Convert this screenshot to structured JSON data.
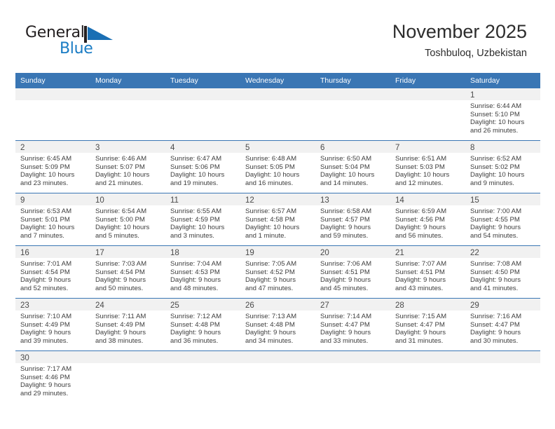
{
  "brand": {
    "name_top": "General",
    "name_bottom": "Blue",
    "flag_icon": "triangle-flag-icon",
    "color_top": "#231f20",
    "color_bottom": "#1a7cc4"
  },
  "header": {
    "title": "November 2025",
    "subtitle": "Toshbuloq, Uzbekistan"
  },
  "colors": {
    "header_blue": "#3a76b4",
    "daynum_band": "#f1f1f1",
    "text": "#3d3d3d"
  },
  "weekday_headers": [
    "Sunday",
    "Monday",
    "Tuesday",
    "Wednesday",
    "Thursday",
    "Friday",
    "Saturday"
  ],
  "weeks": [
    [
      {
        "day": "",
        "sunrise": "",
        "sunset": "",
        "daylight1": "",
        "daylight2": "",
        "empty": true
      },
      {
        "day": "",
        "sunrise": "",
        "sunset": "",
        "daylight1": "",
        "daylight2": "",
        "empty": true
      },
      {
        "day": "",
        "sunrise": "",
        "sunset": "",
        "daylight1": "",
        "daylight2": "",
        "empty": true
      },
      {
        "day": "",
        "sunrise": "",
        "sunset": "",
        "daylight1": "",
        "daylight2": "",
        "empty": true
      },
      {
        "day": "",
        "sunrise": "",
        "sunset": "",
        "daylight1": "",
        "daylight2": "",
        "empty": true
      },
      {
        "day": "",
        "sunrise": "",
        "sunset": "",
        "daylight1": "",
        "daylight2": "",
        "empty": true
      },
      {
        "day": "1",
        "sunrise": "Sunrise: 6:44 AM",
        "sunset": "Sunset: 5:10 PM",
        "daylight1": "Daylight: 10 hours",
        "daylight2": "and 26 minutes."
      }
    ],
    [
      {
        "day": "2",
        "sunrise": "Sunrise: 6:45 AM",
        "sunset": "Sunset: 5:09 PM",
        "daylight1": "Daylight: 10 hours",
        "daylight2": "and 23 minutes."
      },
      {
        "day": "3",
        "sunrise": "Sunrise: 6:46 AM",
        "sunset": "Sunset: 5:07 PM",
        "daylight1": "Daylight: 10 hours",
        "daylight2": "and 21 minutes."
      },
      {
        "day": "4",
        "sunrise": "Sunrise: 6:47 AM",
        "sunset": "Sunset: 5:06 PM",
        "daylight1": "Daylight: 10 hours",
        "daylight2": "and 19 minutes."
      },
      {
        "day": "5",
        "sunrise": "Sunrise: 6:48 AM",
        "sunset": "Sunset: 5:05 PM",
        "daylight1": "Daylight: 10 hours",
        "daylight2": "and 16 minutes."
      },
      {
        "day": "6",
        "sunrise": "Sunrise: 6:50 AM",
        "sunset": "Sunset: 5:04 PM",
        "daylight1": "Daylight: 10 hours",
        "daylight2": "and 14 minutes."
      },
      {
        "day": "7",
        "sunrise": "Sunrise: 6:51 AM",
        "sunset": "Sunset: 5:03 PM",
        "daylight1": "Daylight: 10 hours",
        "daylight2": "and 12 minutes."
      },
      {
        "day": "8",
        "sunrise": "Sunrise: 6:52 AM",
        "sunset": "Sunset: 5:02 PM",
        "daylight1": "Daylight: 10 hours",
        "daylight2": "and 9 minutes."
      }
    ],
    [
      {
        "day": "9",
        "sunrise": "Sunrise: 6:53 AM",
        "sunset": "Sunset: 5:01 PM",
        "daylight1": "Daylight: 10 hours",
        "daylight2": "and 7 minutes."
      },
      {
        "day": "10",
        "sunrise": "Sunrise: 6:54 AM",
        "sunset": "Sunset: 5:00 PM",
        "daylight1": "Daylight: 10 hours",
        "daylight2": "and 5 minutes."
      },
      {
        "day": "11",
        "sunrise": "Sunrise: 6:55 AM",
        "sunset": "Sunset: 4:59 PM",
        "daylight1": "Daylight: 10 hours",
        "daylight2": "and 3 minutes."
      },
      {
        "day": "12",
        "sunrise": "Sunrise: 6:57 AM",
        "sunset": "Sunset: 4:58 PM",
        "daylight1": "Daylight: 10 hours",
        "daylight2": "and 1 minute."
      },
      {
        "day": "13",
        "sunrise": "Sunrise: 6:58 AM",
        "sunset": "Sunset: 4:57 PM",
        "daylight1": "Daylight: 9 hours",
        "daylight2": "and 59 minutes."
      },
      {
        "day": "14",
        "sunrise": "Sunrise: 6:59 AM",
        "sunset": "Sunset: 4:56 PM",
        "daylight1": "Daylight: 9 hours",
        "daylight2": "and 56 minutes."
      },
      {
        "day": "15",
        "sunrise": "Sunrise: 7:00 AM",
        "sunset": "Sunset: 4:55 PM",
        "daylight1": "Daylight: 9 hours",
        "daylight2": "and 54 minutes."
      }
    ],
    [
      {
        "day": "16",
        "sunrise": "Sunrise: 7:01 AM",
        "sunset": "Sunset: 4:54 PM",
        "daylight1": "Daylight: 9 hours",
        "daylight2": "and 52 minutes."
      },
      {
        "day": "17",
        "sunrise": "Sunrise: 7:03 AM",
        "sunset": "Sunset: 4:54 PM",
        "daylight1": "Daylight: 9 hours",
        "daylight2": "and 50 minutes."
      },
      {
        "day": "18",
        "sunrise": "Sunrise: 7:04 AM",
        "sunset": "Sunset: 4:53 PM",
        "daylight1": "Daylight: 9 hours",
        "daylight2": "and 48 minutes."
      },
      {
        "day": "19",
        "sunrise": "Sunrise: 7:05 AM",
        "sunset": "Sunset: 4:52 PM",
        "daylight1": "Daylight: 9 hours",
        "daylight2": "and 47 minutes."
      },
      {
        "day": "20",
        "sunrise": "Sunrise: 7:06 AM",
        "sunset": "Sunset: 4:51 PM",
        "daylight1": "Daylight: 9 hours",
        "daylight2": "and 45 minutes."
      },
      {
        "day": "21",
        "sunrise": "Sunrise: 7:07 AM",
        "sunset": "Sunset: 4:51 PM",
        "daylight1": "Daylight: 9 hours",
        "daylight2": "and 43 minutes."
      },
      {
        "day": "22",
        "sunrise": "Sunrise: 7:08 AM",
        "sunset": "Sunset: 4:50 PM",
        "daylight1": "Daylight: 9 hours",
        "daylight2": "and 41 minutes."
      }
    ],
    [
      {
        "day": "23",
        "sunrise": "Sunrise: 7:10 AM",
        "sunset": "Sunset: 4:49 PM",
        "daylight1": "Daylight: 9 hours",
        "daylight2": "and 39 minutes."
      },
      {
        "day": "24",
        "sunrise": "Sunrise: 7:11 AM",
        "sunset": "Sunset: 4:49 PM",
        "daylight1": "Daylight: 9 hours",
        "daylight2": "and 38 minutes."
      },
      {
        "day": "25",
        "sunrise": "Sunrise: 7:12 AM",
        "sunset": "Sunset: 4:48 PM",
        "daylight1": "Daylight: 9 hours",
        "daylight2": "and 36 minutes."
      },
      {
        "day": "26",
        "sunrise": "Sunrise: 7:13 AM",
        "sunset": "Sunset: 4:48 PM",
        "daylight1": "Daylight: 9 hours",
        "daylight2": "and 34 minutes."
      },
      {
        "day": "27",
        "sunrise": "Sunrise: 7:14 AM",
        "sunset": "Sunset: 4:47 PM",
        "daylight1": "Daylight: 9 hours",
        "daylight2": "and 33 minutes."
      },
      {
        "day": "28",
        "sunrise": "Sunrise: 7:15 AM",
        "sunset": "Sunset: 4:47 PM",
        "daylight1": "Daylight: 9 hours",
        "daylight2": "and 31 minutes."
      },
      {
        "day": "29",
        "sunrise": "Sunrise: 7:16 AM",
        "sunset": "Sunset: 4:47 PM",
        "daylight1": "Daylight: 9 hours",
        "daylight2": "and 30 minutes."
      }
    ],
    [
      {
        "day": "30",
        "sunrise": "Sunrise: 7:17 AM",
        "sunset": "Sunset: 4:46 PM",
        "daylight1": "Daylight: 9 hours",
        "daylight2": "and 29 minutes."
      },
      {
        "day": "",
        "sunrise": "",
        "sunset": "",
        "daylight1": "",
        "daylight2": "",
        "empty": true
      },
      {
        "day": "",
        "sunrise": "",
        "sunset": "",
        "daylight1": "",
        "daylight2": "",
        "empty": true
      },
      {
        "day": "",
        "sunrise": "",
        "sunset": "",
        "daylight1": "",
        "daylight2": "",
        "empty": true
      },
      {
        "day": "",
        "sunrise": "",
        "sunset": "",
        "daylight1": "",
        "daylight2": "",
        "empty": true
      },
      {
        "day": "",
        "sunrise": "",
        "sunset": "",
        "daylight1": "",
        "daylight2": "",
        "empty": true
      },
      {
        "day": "",
        "sunrise": "",
        "sunset": "",
        "daylight1": "",
        "daylight2": "",
        "empty": true
      }
    ]
  ]
}
